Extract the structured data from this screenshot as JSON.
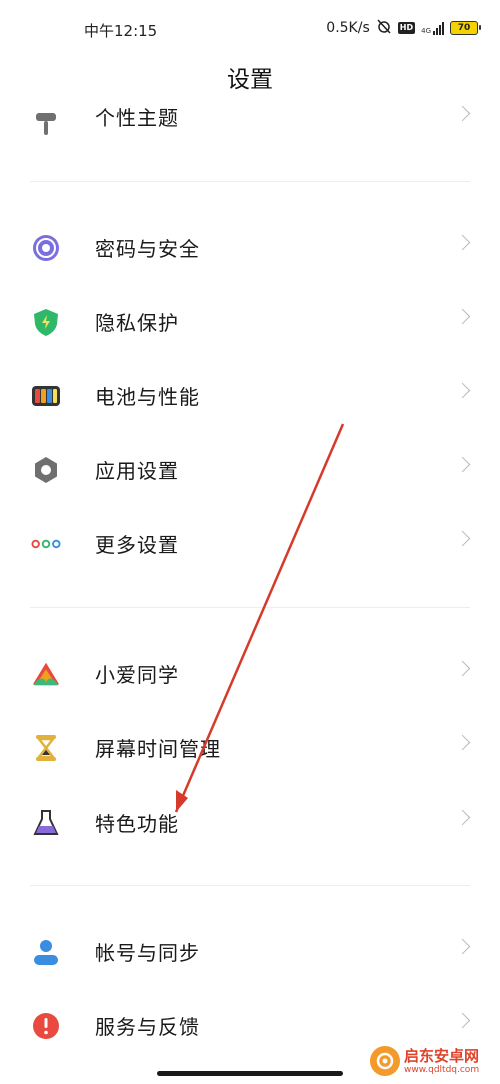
{
  "status_bar": {
    "time": "中午12:15",
    "net_speed": "0.5K/s",
    "hd": "HD",
    "network_type": "4G",
    "battery": "70"
  },
  "header": {
    "title": "设置"
  },
  "partial_item": {
    "label": "个性主题"
  },
  "sections": [
    {
      "items": [
        {
          "label": "密码与安全",
          "icon": "password-security-icon",
          "color": "#7b6fe0"
        },
        {
          "label": "隐私保护",
          "icon": "privacy-shield-icon",
          "color": "#2fb86a"
        },
        {
          "label": "电池与性能",
          "icon": "battery-performance-icon",
          "color": "#f0a020"
        },
        {
          "label": "应用设置",
          "icon": "gear-icon",
          "color": "#6f6f6f"
        },
        {
          "label": "更多设置",
          "icon": "more-dots-icon",
          "color": "#2f9be0"
        }
      ]
    },
    {
      "items": [
        {
          "label": "小爱同学",
          "icon": "xiaoai-icon",
          "color": "#3cb878"
        },
        {
          "label": "屏幕时间管理",
          "icon": "hourglass-icon",
          "color": "#e2b13c"
        },
        {
          "label": "特色功能",
          "icon": "flask-icon",
          "color": "#8a6ad8"
        }
      ]
    },
    {
      "items": [
        {
          "label": "帐号与同步",
          "icon": "account-icon",
          "color": "#3b8de0"
        },
        {
          "label": "服务与反馈",
          "icon": "feedback-icon",
          "color": "#e84a3f"
        }
      ]
    }
  ],
  "watermark": {
    "name": "启东安卓网",
    "url": "www.qdltdq.com"
  },
  "annotation_color": "#d63a2a"
}
